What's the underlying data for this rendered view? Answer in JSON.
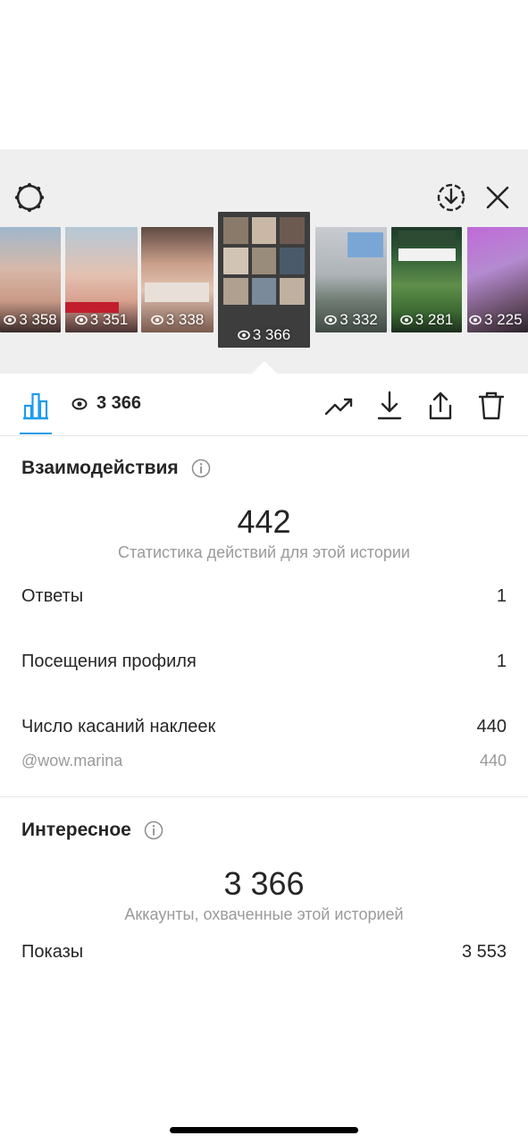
{
  "header": {
    "icons": [
      "settings-icon",
      "download-circle-icon",
      "close-icon"
    ]
  },
  "stories": [
    {
      "views": "3 358"
    },
    {
      "views": "3 351"
    },
    {
      "views": "3 338"
    },
    {
      "views": "3 366",
      "selected": true
    },
    {
      "views": "3 332"
    },
    {
      "views": "3 281"
    },
    {
      "views": "3 225"
    }
  ],
  "toolbar": {
    "view_count": "3 366",
    "icons": [
      "bar-chart-icon",
      "eye-icon",
      "trend-icon",
      "download-icon",
      "share-icon",
      "trash-icon"
    ],
    "accent_color": "#1d9bf0"
  },
  "interactions": {
    "title": "Взаимодействия",
    "total": "442",
    "caption": "Статистика действий для этой истории",
    "rows": [
      {
        "label": "Ответы",
        "value": "1"
      },
      {
        "label": "Посещения профиля",
        "value": "1"
      },
      {
        "label": "Число касаний наклеек",
        "value": "440"
      }
    ],
    "sub_row": {
      "label": "@wow.marina",
      "value": "440"
    }
  },
  "discovery": {
    "title": "Интересное",
    "total": "3 366",
    "caption": "Аккаунты, охваченные этой историей",
    "rows": [
      {
        "label": "Показы",
        "value": "3 553"
      }
    ]
  }
}
